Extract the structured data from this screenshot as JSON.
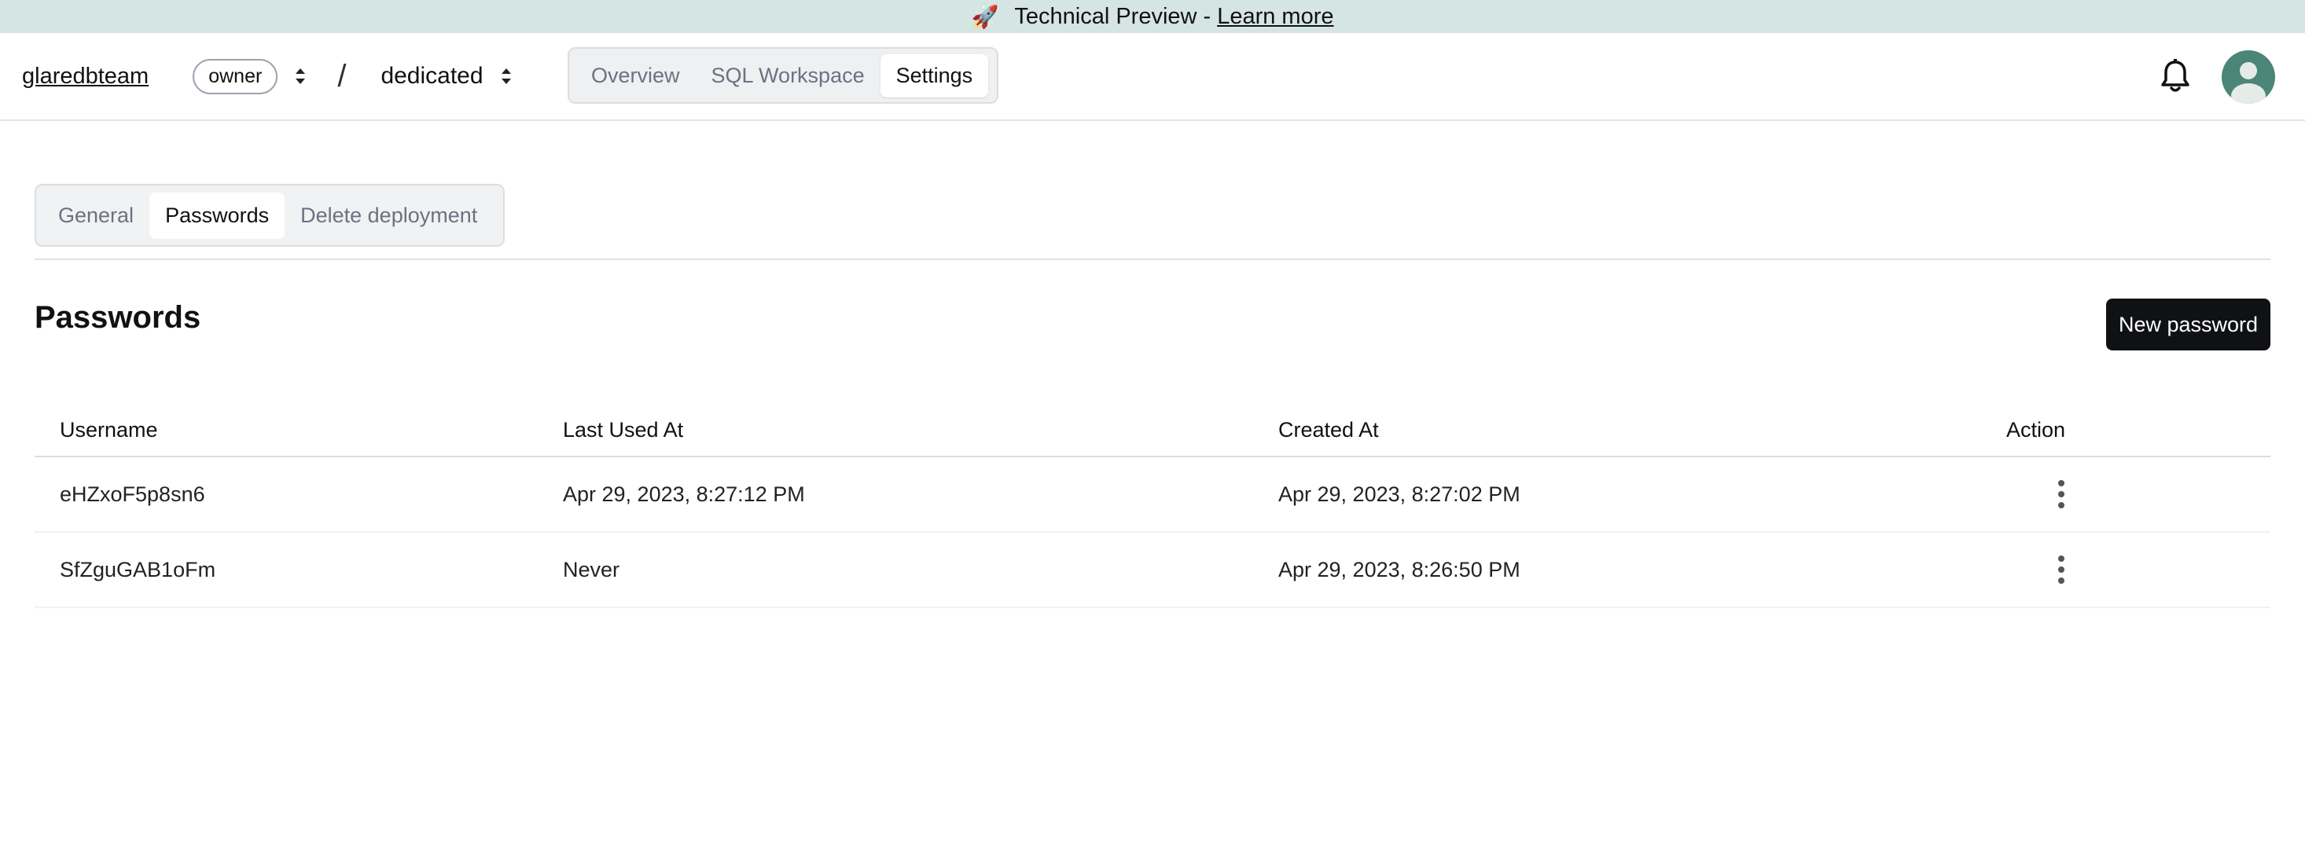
{
  "banner": {
    "text": "Technical Preview - ",
    "link": "Learn more"
  },
  "header": {
    "team": "glaredbteam",
    "role": "owner",
    "separator": "/",
    "deployment": "dedicated",
    "nav": [
      "Overview",
      "SQL Workspace",
      "Settings"
    ],
    "active_nav": "Settings"
  },
  "settings_tabs": [
    "General",
    "Passwords",
    "Delete deployment"
  ],
  "active_settings_tab": "Passwords",
  "page": {
    "title": "Passwords",
    "new_button": "New password"
  },
  "table": {
    "columns": [
      "Username",
      "Last Used At",
      "Created At",
      "Action"
    ],
    "rows": [
      {
        "username": "eHZxoF5p8sn6",
        "last_used": "Apr 29, 2023, 8:27:12 PM",
        "created": "Apr 29, 2023, 8:27:02 PM"
      },
      {
        "username": "SfZguGAB1oFm",
        "last_used": "Never",
        "created": "Apr 29, 2023, 8:26:50 PM"
      }
    ]
  },
  "icons": {
    "banner": "rocket-icon",
    "notifications": "bell-icon",
    "user": "avatar-icon",
    "row_action": "kebab-menu-icon",
    "selector": "chevron-up-down-icon"
  },
  "colors": {
    "banner_bg": "#d5e5e4",
    "button_bg": "#0f1115",
    "avatar_bg": "#4b8577"
  }
}
